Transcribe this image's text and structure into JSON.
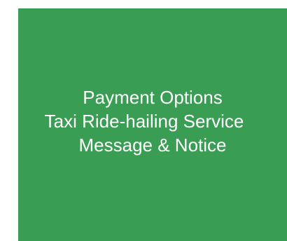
{
  "menu": {
    "items": [
      {
        "label": "Payment Options"
      },
      {
        "label": "Taxi Ride-hailing Service"
      },
      {
        "label": "Message & Notice"
      }
    ]
  },
  "colors": {
    "panel_background": "#3a9d54",
    "text": "#ffffff",
    "page_background": "#ffffff"
  }
}
